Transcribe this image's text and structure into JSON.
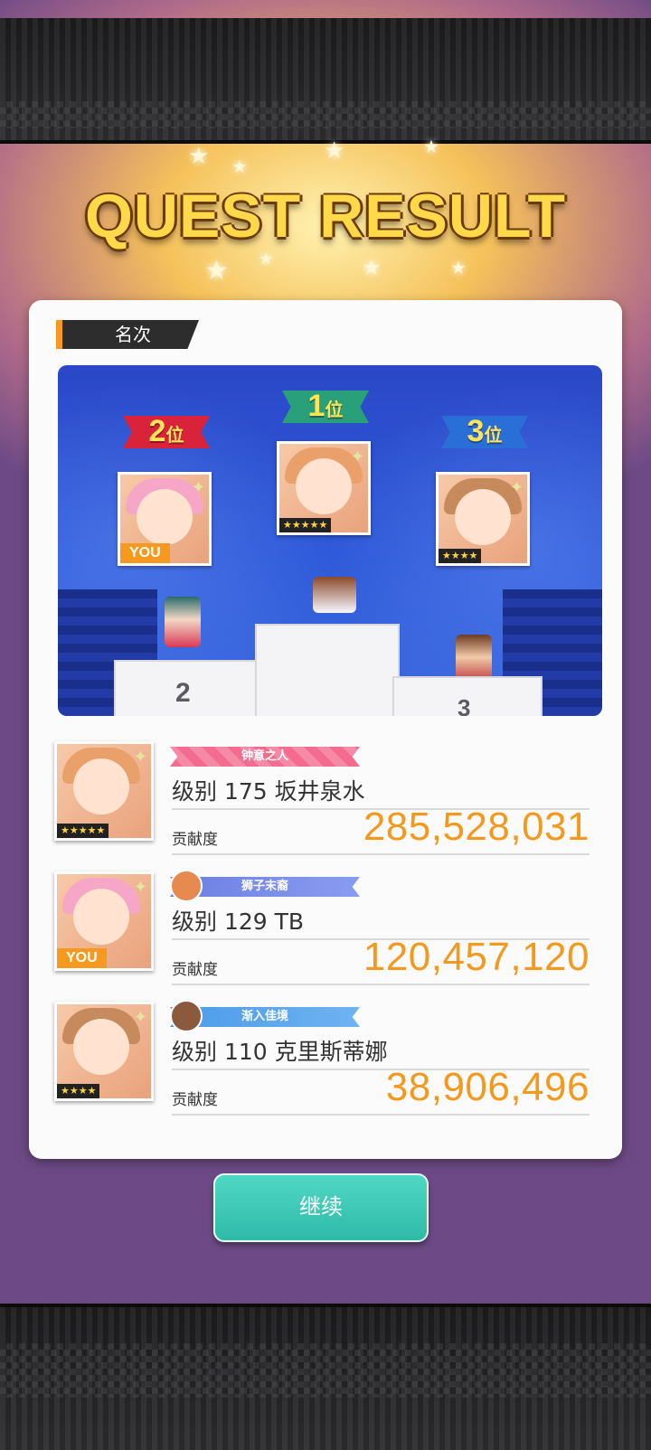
{
  "header": {
    "title": "QUEST RESULT"
  },
  "section": {
    "label": "名次"
  },
  "podium": {
    "first": {
      "rank_num": "1",
      "rank_suffix": "位",
      "stars": "★★★★★",
      "label": ""
    },
    "second": {
      "rank_num": "2",
      "rank_suffix": "位",
      "you": "YOU",
      "label": "2"
    },
    "third": {
      "rank_num": "3",
      "rank_suffix": "位",
      "stars": "★★★★",
      "label": "3"
    }
  },
  "results": [
    {
      "title_badge": "钟意之人",
      "level_label": "级别",
      "level": "175",
      "name": "坂井泉水",
      "contrib_label": "贡献度",
      "contribution": "285,528,031",
      "stars": "★★★★★",
      "banner_color": "#f05c8a"
    },
    {
      "title_badge": "狮子末裔",
      "level_label": "级别",
      "level": "129",
      "name": "TB",
      "contrib_label": "贡献度",
      "contribution": "120,457,120",
      "you": "YOU",
      "banner_color": "#5a6fd8"
    },
    {
      "title_badge": "渐入佳境",
      "level_label": "级别",
      "level": "110",
      "name": "克里斯蒂娜",
      "contrib_label": "贡献度",
      "contribution": "38,906,496",
      "stars": "★★★★",
      "banner_color": "#3f8de0"
    }
  ],
  "continue_button": {
    "label": "继续"
  },
  "colors": {
    "accent": "#f39a1e",
    "button": "#2fb9a8"
  },
  "icons": {
    "star": "star-icon",
    "sparkle": "sparkle-icon"
  }
}
